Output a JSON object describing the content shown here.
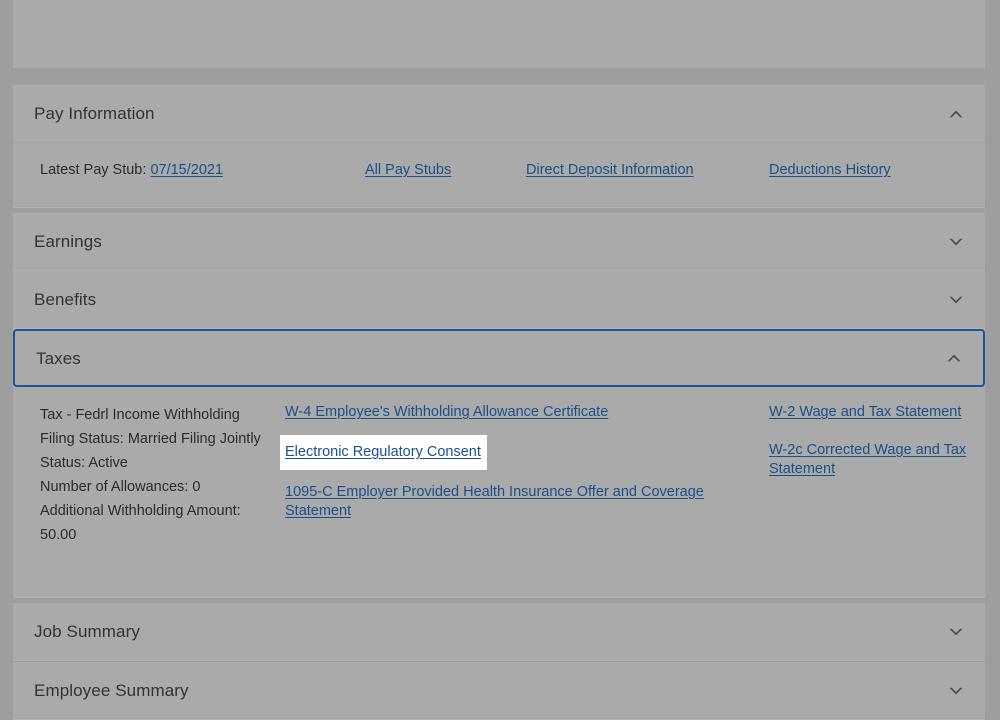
{
  "page": {
    "background_color": "#9e9e9e",
    "panel_color": "#aaaaaa",
    "link_color": "#1b4f8a",
    "focus_border_color": "#17569c",
    "expanded_divider_color": "#a8a488"
  },
  "sections": {
    "pay_information": {
      "title": "Pay Information",
      "state": "expanded",
      "chevron": "chevron-up-icon",
      "body": {
        "latest_pay_stub_label": "Latest Pay Stub:",
        "latest_pay_stub_date": "07/15/2021",
        "all_pay_stubs": "All Pay Stubs",
        "direct_deposit_information": "Direct Deposit Information",
        "deductions_history": "Deductions History"
      }
    },
    "earnings": {
      "title": "Earnings",
      "state": "collapsed",
      "chevron": "chevron-down-icon"
    },
    "benefits": {
      "title": "Benefits",
      "state": "collapsed",
      "chevron": "chevron-down-icon"
    },
    "taxes": {
      "title": "Taxes",
      "state": "expanded",
      "focused": true,
      "chevron": "chevron-up-icon",
      "details": {
        "tax_type": "Tax - Fedrl Income Withholding",
        "filing_status": "Filing Status: Married Filing Jointly",
        "status": "Status: Active",
        "number_of_allowances": "Number of Allowances: 0",
        "additional_withholding": "Additional Withholding Amount: 50.00"
      },
      "middle_links": {
        "w4": "W-4 Employee's Withholding Allowance Certificate",
        "electronic_regulatory_consent": "Electronic Regulatory Consent",
        "form_1095c": "1095-C Employer Provided Health Insurance Offer and Coverage Statement"
      },
      "right_links": {
        "w2": "W-2 Wage and Tax Statement",
        "w2c": "W-2c Corrected Wage and Tax Statement"
      }
    },
    "job_summary": {
      "title": "Job Summary",
      "state": "collapsed",
      "chevron": "chevron-down-icon"
    },
    "employee_summary": {
      "title": "Employee Summary",
      "state": "collapsed",
      "chevron": "chevron-down-icon"
    }
  }
}
